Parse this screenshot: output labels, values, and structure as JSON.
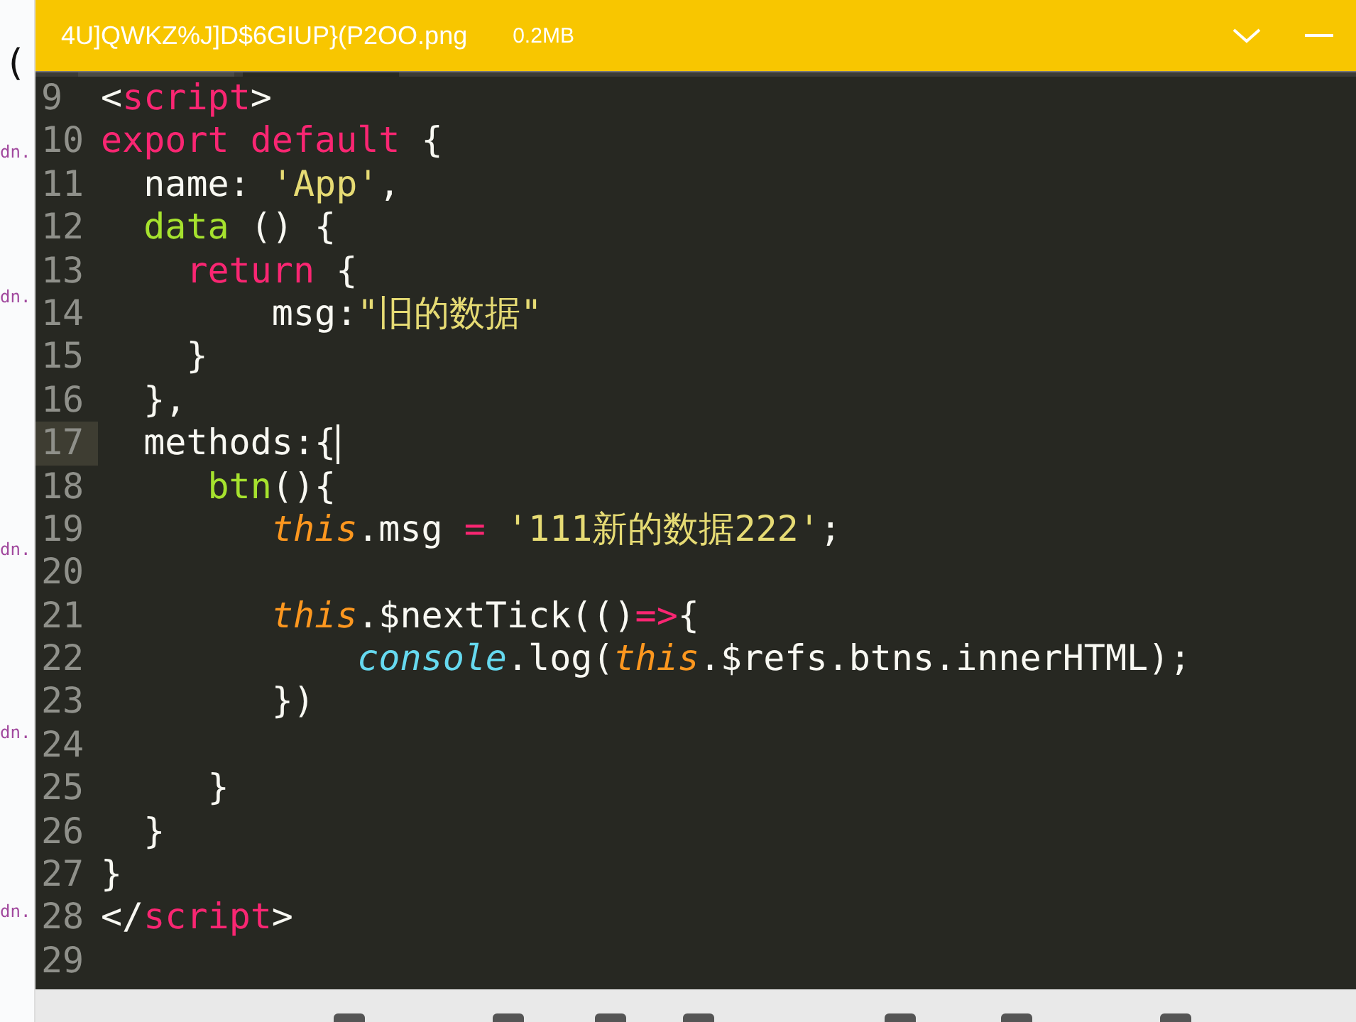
{
  "background_page": {
    "paren": "(",
    "snippets": [
      "dn.",
      "dn.",
      "dn.",
      "dn.",
      "dn."
    ]
  },
  "viewer": {
    "file_name": "4U]QWKZ%J]D$6GIUP}(P2OO.png",
    "file_size": "0.2MB"
  },
  "editor": {
    "lines": [
      {
        "number": "9",
        "current": false,
        "tokens": [
          {
            "text": "<",
            "kind": "punct"
          },
          {
            "text": "script",
            "kind": "tag"
          },
          {
            "text": ">",
            "kind": "punct"
          }
        ]
      },
      {
        "number": "10",
        "current": false,
        "tokens": [
          {
            "text": "export default",
            "kind": "keyword"
          },
          {
            "text": " {",
            "kind": "punct"
          }
        ]
      },
      {
        "number": "11",
        "current": false,
        "tokens": [
          {
            "text": "  name: ",
            "kind": "punct"
          },
          {
            "text": "'App'",
            "kind": "string"
          },
          {
            "text": ",",
            "kind": "punct"
          }
        ]
      },
      {
        "number": "12",
        "current": false,
        "tokens": [
          {
            "text": "  data",
            "kind": "func"
          },
          {
            "text": " () {",
            "kind": "punct"
          }
        ]
      },
      {
        "number": "13",
        "current": false,
        "tokens": [
          {
            "text": "    return",
            "kind": "keyword"
          },
          {
            "text": " {",
            "kind": "punct"
          }
        ]
      },
      {
        "number": "14",
        "current": false,
        "tokens": [
          {
            "text": "        msg:",
            "kind": "punct"
          },
          {
            "text": "\"旧的数据\"",
            "kind": "string"
          }
        ]
      },
      {
        "number": "15",
        "current": false,
        "tokens": [
          {
            "text": "    }",
            "kind": "punct"
          }
        ]
      },
      {
        "number": "16",
        "current": false,
        "tokens": [
          {
            "text": "  },",
            "kind": "punct"
          }
        ]
      },
      {
        "number": "17",
        "current": true,
        "tokens": [
          {
            "text": "  methods:{",
            "kind": "punct"
          }
        ]
      },
      {
        "number": "18",
        "current": false,
        "tokens": [
          {
            "text": "     btn",
            "kind": "func"
          },
          {
            "text": "(){",
            "kind": "punct"
          }
        ]
      },
      {
        "number": "19",
        "current": false,
        "tokens": [
          {
            "text": "        this",
            "kind": "this"
          },
          {
            "text": ".msg ",
            "kind": "punct"
          },
          {
            "text": "=",
            "kind": "keyword"
          },
          {
            "text": " '111新的数据222'",
            "kind": "string"
          },
          {
            "text": ";",
            "kind": "punct"
          }
        ]
      },
      {
        "number": "20",
        "current": false
      },
      {
        "number": "21",
        "current": false,
        "tokens": [
          {
            "text": "        this",
            "kind": "this"
          },
          {
            "text": ".$nextTick(()",
            "kind": "punct"
          },
          {
            "text": "=>",
            "kind": "keyword"
          },
          {
            "text": "{",
            "kind": "punct"
          }
        ]
      },
      {
        "number": "22",
        "current": false,
        "tokens": [
          {
            "text": "            console",
            "kind": "builtin"
          },
          {
            "text": ".log(",
            "kind": "punct"
          },
          {
            "text": "this",
            "kind": "this"
          },
          {
            "text": ".$refs.btns.innerHTML);",
            "kind": "punct"
          }
        ]
      },
      {
        "number": "23",
        "current": false,
        "tokens": [
          {
            "text": "        })",
            "kind": "punct"
          }
        ]
      },
      {
        "number": "24",
        "current": false
      },
      {
        "number": "25",
        "current": false,
        "tokens": [
          {
            "text": "     }",
            "kind": "punct"
          }
        ]
      },
      {
        "number": "26",
        "current": false,
        "tokens": [
          {
            "text": "  }",
            "kind": "punct"
          }
        ]
      },
      {
        "number": "27",
        "current": false,
        "tokens": [
          {
            "text": "}",
            "kind": "punct"
          }
        ]
      },
      {
        "number": "28",
        "current": false,
        "tokens": [
          {
            "text": "</",
            "kind": "punct"
          },
          {
            "text": "script",
            "kind": "tag"
          },
          {
            "text": ">",
            "kind": "punct"
          }
        ]
      },
      {
        "number": "29",
        "current": false
      }
    ]
  }
}
